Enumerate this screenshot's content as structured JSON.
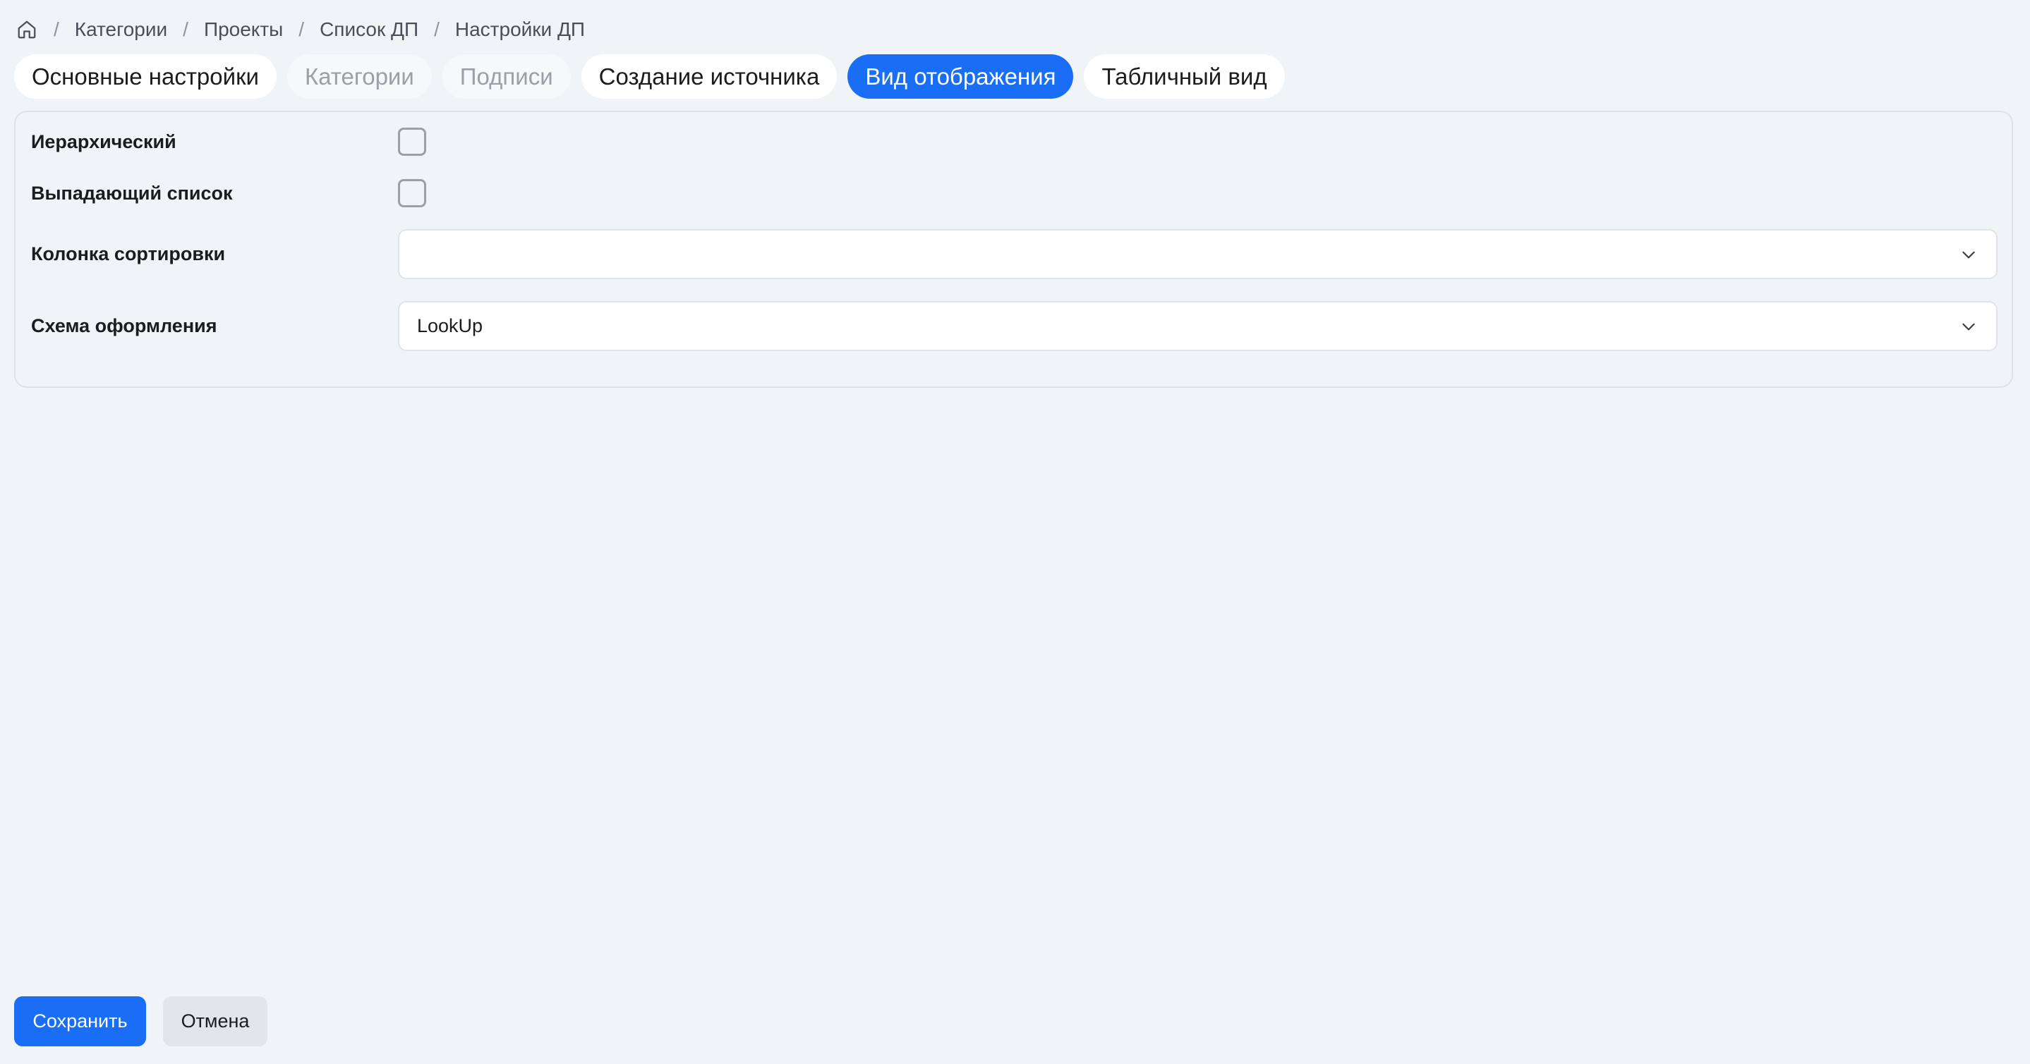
{
  "breadcrumb": {
    "home_icon": "home-icon",
    "items": [
      "Категории",
      "Проекты",
      "Список ДП",
      "Настройки ДП"
    ],
    "separator": "/"
  },
  "tabs": [
    {
      "label": "Основные настройки",
      "state": "normal"
    },
    {
      "label": "Категории",
      "state": "disabled"
    },
    {
      "label": "Подписи",
      "state": "disabled"
    },
    {
      "label": "Создание источника",
      "state": "normal"
    },
    {
      "label": "Вид отображения",
      "state": "active"
    },
    {
      "label": "Табличный вид",
      "state": "normal"
    }
  ],
  "form": {
    "hierarchical": {
      "label": "Иерархический",
      "checked": false
    },
    "dropdown_list": {
      "label": "Выпадающий список",
      "checked": false
    },
    "sort_column": {
      "label": "Колонка сортировки",
      "value": ""
    },
    "design_scheme": {
      "label": "Схема оформления",
      "value": "LookUp"
    }
  },
  "footer": {
    "save_label": "Сохранить",
    "cancel_label": "Отмена"
  },
  "colors": {
    "accent": "#1a6ef5",
    "background": "#f0f4f7"
  }
}
